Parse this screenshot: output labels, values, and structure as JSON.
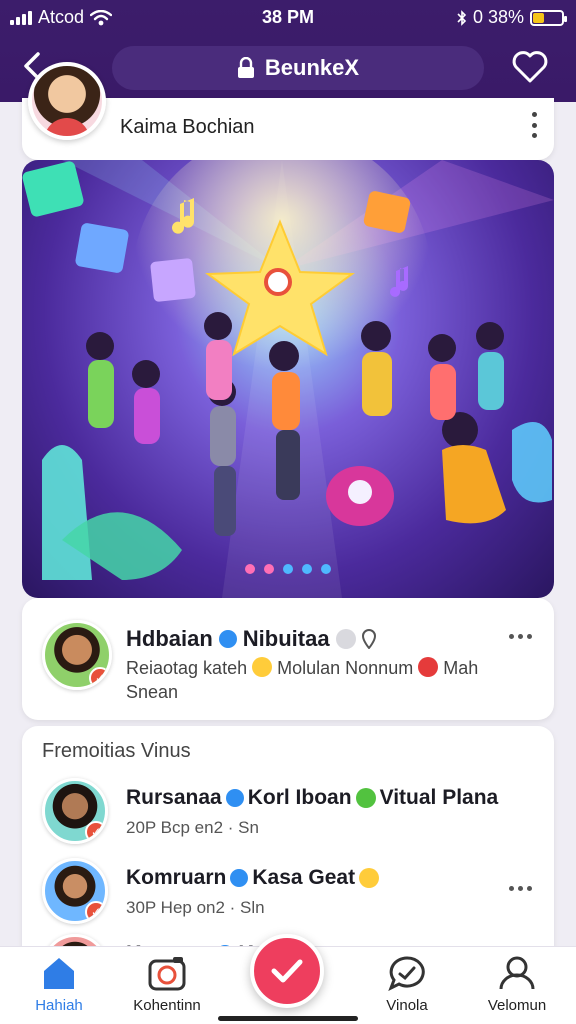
{
  "status_bar": {
    "carrier": "Atcod",
    "time": "38 PM",
    "battery": "0 38%",
    "battery_level": 0.38
  },
  "header": {
    "title": "BeunkeX",
    "back_icon": "chevron-left-icon",
    "lock_icon": "lock-icon",
    "favorite_icon": "heart-icon"
  },
  "profile": {
    "name": "Kaima Bochian"
  },
  "hero": {
    "carousel_dot_count": 5
  },
  "post": {
    "title": "Hdbaian",
    "title_2": "Nibuitaa",
    "meta_1": "Reiaotag kateh",
    "meta_2": "Molulan Nonnum",
    "meta_3": "Mah",
    "meta_4": "Snean"
  },
  "featured": {
    "title": "Fremoitias Vinus",
    "items": [
      {
        "name_1": "Rursanaa",
        "name_2": "Korl Iboan",
        "name_3": "Vitual Plana",
        "subtitle": "20P Bcp en2 · Sn"
      },
      {
        "name_1": "Komruarn",
        "name_2": "Kasa Geat",
        "name_3": "",
        "subtitle": "30P Hep on2 · Sln"
      },
      {
        "name_1": "Komrum",
        "name_2": "Ka",
        "name_3": "",
        "subtitle": ""
      }
    ]
  },
  "nav": {
    "items": [
      {
        "label": "Hahiah",
        "icon": "home-icon",
        "active": true
      },
      {
        "label": "Kohentinn",
        "icon": "camera-icon",
        "active": false
      },
      {
        "label": "Vinola",
        "icon": "chat-icon",
        "active": false
      },
      {
        "label": "Velomun",
        "icon": "profile-icon",
        "active": false
      }
    ],
    "fab_icon": "checkmark-icon"
  },
  "colors": {
    "header": "#3c1d6b",
    "accent_blue": "#2f7de6",
    "fab": "#ee3e5e"
  }
}
